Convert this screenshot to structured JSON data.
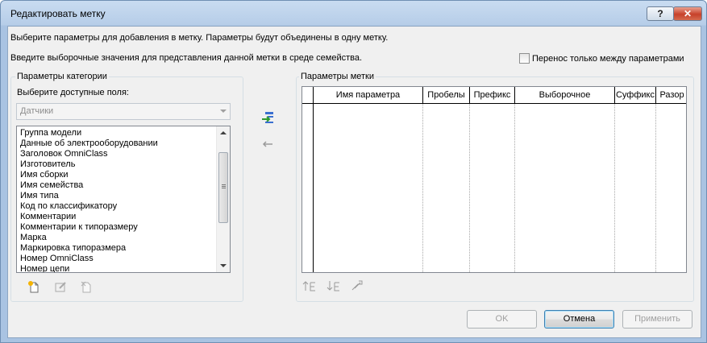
{
  "window": {
    "title": "Редактировать метку",
    "help_label": "?",
    "close_label": "✕"
  },
  "instructions": {
    "line1": "Выберите параметры для добавления в метку.  Параметры будут объединены в одну метку.",
    "line2": "Введите выборочные значения для представления данной метки в среде семейства."
  },
  "transfer_checkbox": {
    "label": "Перенос только между параметрами",
    "checked": false
  },
  "category_params": {
    "group_title": "Параметры категории",
    "fields_label": "Выберите доступные поля:",
    "category_value": "Датчики",
    "items": [
      "Группа модели",
      "Данные об электрооборудовании",
      "Заголовок OmniClass",
      "Изготовитель",
      "Имя сборки",
      "Имя семейства",
      "Имя типа",
      "Код по классификатору",
      "Комментарии",
      "Комментарии к типоразмеру",
      "Марка",
      "Маркировка типоразмера",
      "Номер OmniClass",
      "Номер цепи"
    ]
  },
  "transfer": {
    "add_icon": "add-parameter-icon",
    "remove_icon": "remove-parameter-icon"
  },
  "label_params": {
    "group_title": "Параметры метки",
    "columns": [
      "",
      "Имя параметра",
      "Пробелы",
      "Префикс",
      "Выборочное",
      "Суффикс",
      "Разор"
    ]
  },
  "bottom_icons": {
    "left": [
      "new-parameter-icon",
      "edit-parameter-icon",
      "delete-parameter-icon"
    ],
    "right": [
      "move-up-icon",
      "move-down-icon",
      "sort-icon"
    ]
  },
  "buttons": {
    "ok": "OK",
    "cancel": "Отмена",
    "apply": "Применить"
  },
  "colors": {
    "title_bar": "#b6cde8",
    "close_button": "#c7412a",
    "dialog_bg": "#f0f0f0",
    "default_button_border": "#3c7fb1"
  }
}
